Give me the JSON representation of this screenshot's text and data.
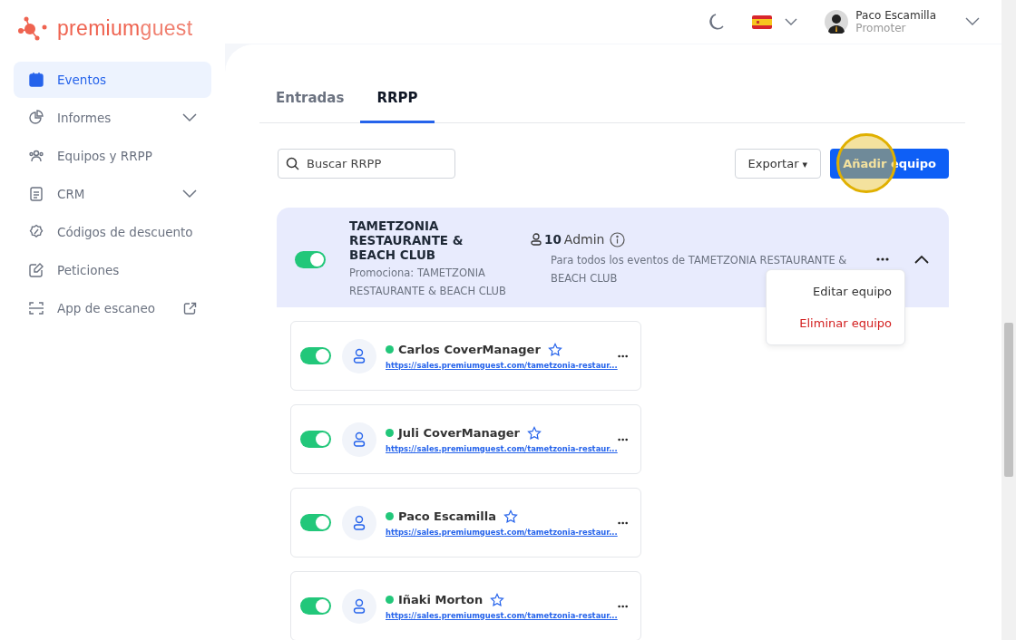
{
  "brand": {
    "name_bold": "premium",
    "name_light": "guest"
  },
  "sidebar": {
    "items": [
      {
        "label": "Eventos",
        "kind": "calendar",
        "selected": true,
        "expandable": false,
        "external": false
      },
      {
        "label": "Informes",
        "kind": "chart",
        "selected": false,
        "expandable": true,
        "external": false
      },
      {
        "label": "Equipos y RRPP",
        "kind": "people",
        "selected": false,
        "expandable": false,
        "external": false
      },
      {
        "label": "CRM",
        "kind": "document",
        "selected": false,
        "expandable": true,
        "external": false
      },
      {
        "label": "Códigos de descuento",
        "kind": "discount",
        "selected": false,
        "expandable": false,
        "external": false
      },
      {
        "label": "Peticiones",
        "kind": "edit",
        "selected": false,
        "expandable": false,
        "external": false
      },
      {
        "label": "App de escaneo",
        "kind": "scan",
        "selected": false,
        "expandable": false,
        "external": true
      }
    ]
  },
  "user": {
    "name": "Paco Escamilla",
    "role": "Promoter"
  },
  "tabs": [
    {
      "label": "Entradas",
      "selected": false
    },
    {
      "label": "RRPP",
      "selected": true
    }
  ],
  "search": {
    "placeholder": "Buscar RRPP"
  },
  "export_button": "Exportar",
  "export_caret": "▾",
  "add_button": "Añadir equipo",
  "team": {
    "on": true,
    "name": "TAMETZONIA RESTAURANTE & BEACH CLUB",
    "promotes": "Promociona: TAMETZONIA RESTAURANTE & BEACH CLUB",
    "count": "10",
    "role": "Admin",
    "scope": "Para todos los eventos de TAMETZONIA RESTAURANTE & BEACH CLUB",
    "expanded": true,
    "menu": [
      "Editar equipo",
      "Eliminar equipo"
    ],
    "members": [
      {
        "name": "Carlos CoverManager",
        "url": "https://sales.premiumguest.com/tametzonia-restaur...",
        "on": true,
        "color": "#22c77a",
        "starred": false
      },
      {
        "name": "Juli CoverManager",
        "url": "https://sales.premiumguest.com/tametzonia-restaur...",
        "on": true,
        "color": "#22c77a",
        "starred": false
      },
      {
        "name": "Paco Escamilla",
        "url": "https://sales.premiumguest.com/tametzonia-restaur...",
        "on": true,
        "color": "#22c77a",
        "starred": false
      },
      {
        "name": "Iñaki Morton",
        "url": "https://sales.premiumguest.com/tametzonia-restaur...",
        "on": true,
        "color": "#22c77a",
        "starred": false
      }
    ]
  }
}
